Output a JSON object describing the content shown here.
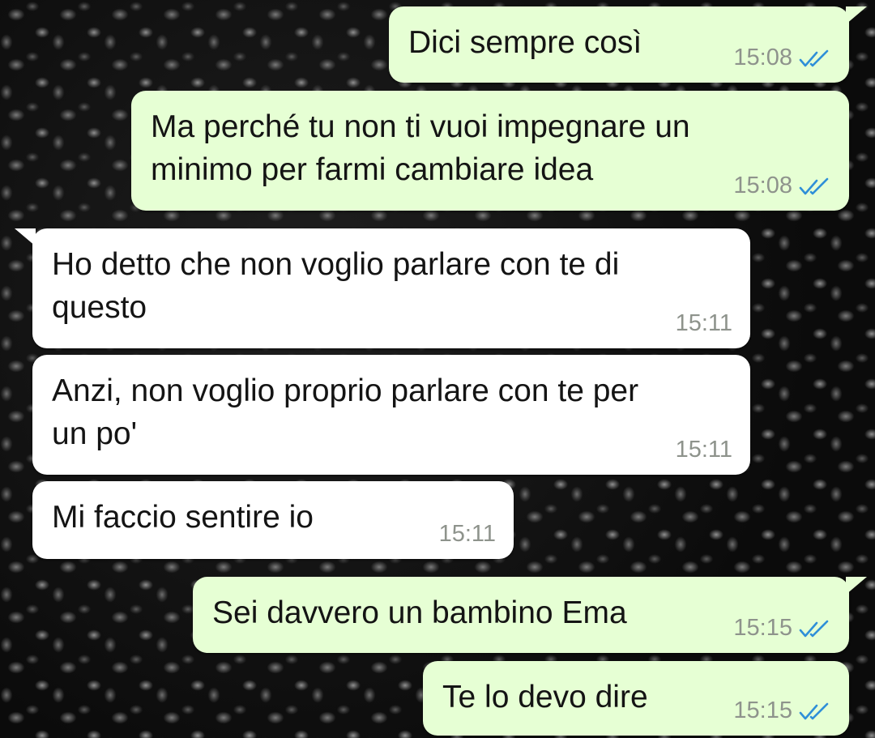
{
  "colors": {
    "outgoing_bubble": "#e6ffd4",
    "incoming_bubble": "#ffffff",
    "read_ticks": "#2f8fd8",
    "timestamp": "#8e938c"
  },
  "messages": [
    {
      "direction": "outgoing",
      "lines": [
        "Dici sempre così"
      ],
      "time": "15:08",
      "status_icon": "double-check-read-icon"
    },
    {
      "direction": "outgoing",
      "lines": [
        "Ma perché tu non ti vuoi impegnare un",
        "minimo per farmi cambiare idea"
      ],
      "time": "15:08",
      "status_icon": "double-check-read-icon"
    },
    {
      "direction": "incoming",
      "lines": [
        "Ho detto che non voglio parlare con te di",
        "questo"
      ],
      "time": "15:11"
    },
    {
      "direction": "incoming",
      "lines": [
        "Anzi, non voglio proprio parlare con te per",
        "un po'"
      ],
      "time": "15:11"
    },
    {
      "direction": "incoming",
      "lines": [
        "Mi faccio sentire io"
      ],
      "time": "15:11"
    },
    {
      "direction": "outgoing",
      "lines": [
        "Sei davvero un bambino Ema"
      ],
      "time": "15:15",
      "status_icon": "double-check-read-icon"
    },
    {
      "direction": "outgoing",
      "lines": [
        "Te lo devo dire"
      ],
      "time": "15:15",
      "status_icon": "double-check-read-icon"
    }
  ]
}
